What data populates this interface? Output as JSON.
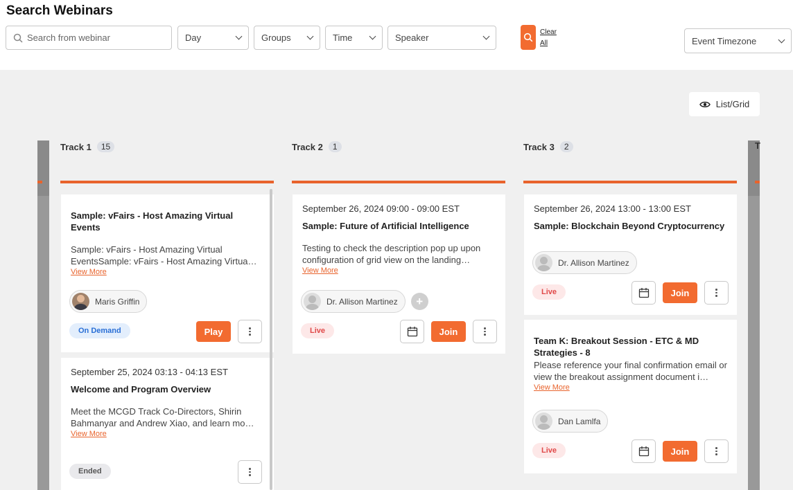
{
  "header": {
    "title": "Search Webinars",
    "search_placeholder": "Search from webinar",
    "filters": {
      "day": "Day",
      "groups": "Groups",
      "time": "Time",
      "speaker": "Speaker"
    },
    "clear_all": "Clear All",
    "timezone": "Event Timezone"
  },
  "toolbar": {
    "list_grid_label": "List/Grid"
  },
  "tracks": [
    {
      "name": "Track 1",
      "count": "15"
    },
    {
      "name": "Track 2",
      "count": "1"
    },
    {
      "name": "Track 3",
      "count": "2"
    },
    {
      "name": "T"
    }
  ],
  "cards": {
    "t1c1": {
      "title": "Sample: vFairs - Host Amazing Virtual Events",
      "desc": "Sample: vFairs - Host Amazing Virtual EventsSample: vFairs - Host Amazing Virtua…",
      "view_more": "View More",
      "speaker": "Maris Griffin",
      "status": "On Demand",
      "action": "Play"
    },
    "t1c2": {
      "date": "September 25, 2024 03:13 - 04:13 EST",
      "title": "Welcome and Program Overview",
      "desc": "Meet the MCGD Track Co-Directors, Shirin Bahmanyar and Andrew Xiao, and learn mo…",
      "view_more": "View More",
      "status": "Ended"
    },
    "t2c1": {
      "date": "September 26, 2024 09:00 - 09:00 EST",
      "title": "Sample: Future of Artificial Intelligence",
      "desc": "Testing to check the description pop up upon configuration of grid view on the landing…",
      "view_more": "View More",
      "speaker": "Dr. Allison Martinez",
      "status": "Live",
      "action": "Join"
    },
    "t3c1": {
      "date": "September 26, 2024 13:00 - 13:00 EST",
      "title": "Sample: Blockchain Beyond Cryptocurrency",
      "speaker": "Dr. Allison Martinez",
      "status": "Live",
      "action": "Join"
    },
    "t3c2": {
      "title": "Team K: Breakout Session - ETC & MD Strategies - 8",
      "desc": "Please reference your final confirmation email or view the breakout assignment document i…",
      "view_more": "View More",
      "speaker": "Dan Lamlfa",
      "status": "Live",
      "action": "Join"
    }
  },
  "colors": {
    "accent": "#f26b30",
    "live": "#e04848",
    "on_demand": "#2a6fd6"
  }
}
